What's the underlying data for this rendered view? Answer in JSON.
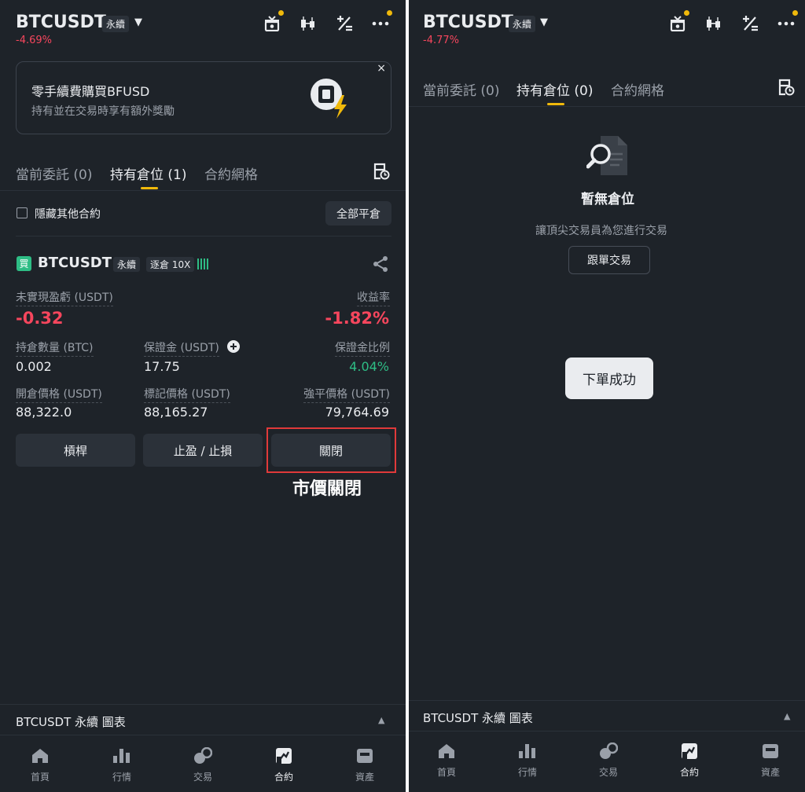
{
  "colors": {
    "background": "#1e2329",
    "accent": "#f0b90b",
    "negative": "#f6465d",
    "positive": "#2ebd85",
    "highlight_box": "#e03a3a"
  },
  "left": {
    "header": {
      "symbol": "BTCUSDT",
      "contract_type": "永續",
      "change": "-4.69%",
      "icons": [
        "gift-icon",
        "candlestick-icon",
        "percent-calc-icon",
        "more-icon"
      ]
    },
    "promo": {
      "title": "零手續費購買BFUSD",
      "subtitle": "持有並在交易時享有額外獎勵",
      "close": "×"
    },
    "tabs": [
      {
        "label": "當前委託 (0)",
        "active": false
      },
      {
        "label": "持有倉位 (1)",
        "active": true
      },
      {
        "label": "合約網格",
        "active": false
      }
    ],
    "filter": {
      "hide_other_label": "隱藏其他合約",
      "close_all_label": "全部平倉"
    },
    "position": {
      "side_badge": "買",
      "symbol": "BTCUSDT",
      "contract_type": "永續",
      "margin_mode": "逐倉 10X",
      "unrealized_pnl_label": "未實現盈虧 (USDT)",
      "unrealized_pnl": "-0.32",
      "roe_label": "收益率",
      "roe": "-1.82%",
      "size_label": "持倉數量 (BTC)",
      "size": "0.002",
      "margin_label": "保證金 (USDT)",
      "margin": "17.75",
      "margin_ratio_label": "保證金比例",
      "margin_ratio": "4.04%",
      "entry_price_label": "開倉價格 (USDT)",
      "entry_price": "88,322.0",
      "mark_price_label": "標記價格 (USDT)",
      "mark_price": "88,165.27",
      "liq_price_label": "強平價格 (USDT)",
      "liq_price": "79,764.69"
    },
    "actions": {
      "leverage": "槓桿",
      "tp_sl": "止盈 / 止損",
      "close": "關閉"
    },
    "annotation": "市價關閉",
    "chart_bar": "BTCUSDT 永續  圖表"
  },
  "right": {
    "header": {
      "symbol": "BTCUSDT",
      "contract_type": "永續",
      "change": "-4.77%"
    },
    "tabs": [
      {
        "label": "當前委託 (0)",
        "active": false
      },
      {
        "label": "持有倉位 (0)",
        "active": true
      },
      {
        "label": "合約網格",
        "active": false
      }
    ],
    "empty": {
      "title": "暫無倉位",
      "subtitle": "讓頂尖交易員為您進行交易",
      "button": "跟單交易"
    },
    "toast": "下單成功",
    "chart_bar": "BTCUSDT 永續  圖表"
  },
  "bottom_nav": [
    {
      "label": "首頁",
      "icon": "home-icon",
      "active": false
    },
    {
      "label": "行情",
      "icon": "markets-icon",
      "active": false
    },
    {
      "label": "交易",
      "icon": "trade-icon",
      "active": false
    },
    {
      "label": "合約",
      "icon": "futures-icon",
      "active": true
    },
    {
      "label": "資產",
      "icon": "wallet-icon",
      "active": false
    }
  ]
}
